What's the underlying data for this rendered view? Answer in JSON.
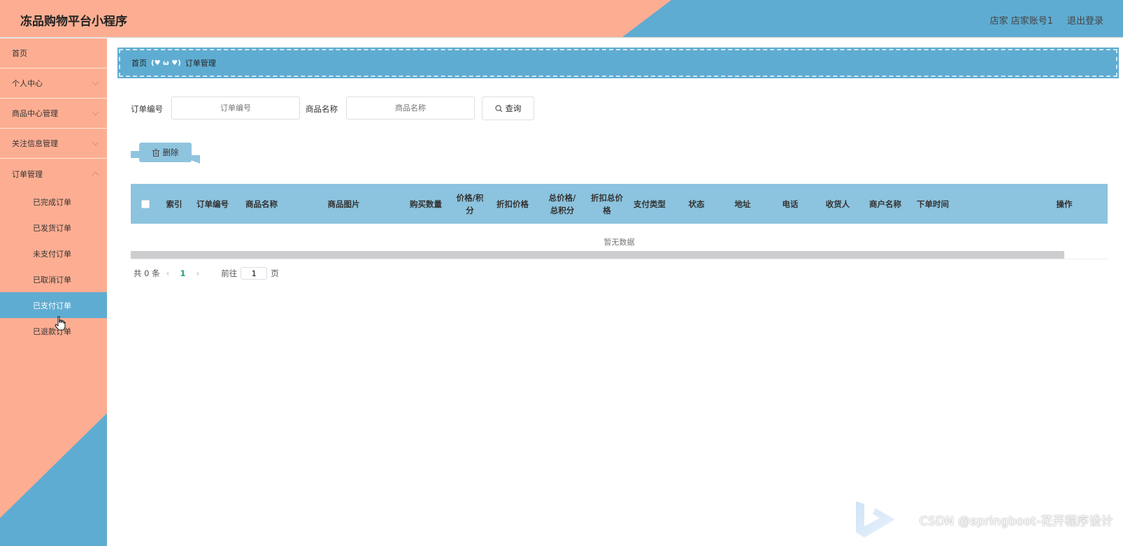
{
  "header": {
    "app_title": "冻品购物平台小程序",
    "user_info": "店家 店家账号1",
    "logout_label": "退出登录"
  },
  "sidebar": {
    "items": [
      {
        "label": "首页",
        "has_children": false
      },
      {
        "label": "个人中心",
        "has_children": true
      },
      {
        "label": "商品中心管理",
        "has_children": true
      },
      {
        "label": "关注信息管理",
        "has_children": true
      },
      {
        "label": "订单管理",
        "has_children": true
      }
    ],
    "sub_items": [
      {
        "label": "已完成订单",
        "active": false
      },
      {
        "label": "已发货订单",
        "active": false
      },
      {
        "label": "未支付订单",
        "active": false
      },
      {
        "label": "已取消订单",
        "active": false
      },
      {
        "label": "已支付订单",
        "active": true
      },
      {
        "label": "已退款订单",
        "active": false
      }
    ]
  },
  "breadcrumb": {
    "home": "首页",
    "separator": "(♥ ω ♥)",
    "current": "订单管理"
  },
  "search": {
    "order_no_label": "订单编号",
    "order_no_placeholder": "订单编号",
    "product_name_label": "商品名称",
    "product_name_placeholder": "商品名称",
    "query_label": "查询"
  },
  "actions": {
    "delete_label": "删除"
  },
  "table": {
    "columns": [
      "索引",
      "订单编号",
      "商品名称",
      "商品图片",
      "购买数量",
      "价格/积分",
      "折扣价格",
      "总价格/总积分",
      "折扣总价格",
      "支付类型",
      "状态",
      "地址",
      "电话",
      "收货人",
      "商户名称",
      "下单时间",
      "操作"
    ],
    "empty_text": "暂无数据"
  },
  "pagination": {
    "total_text": "共 0 条",
    "current_page": "1",
    "goto_label": "前往",
    "goto_value": "1",
    "page_suffix": "页"
  },
  "watermark": "CSDN @springboot-花开程序设计",
  "colors": {
    "salmon": "#fdae92",
    "blue": "#5facd2",
    "table_header": "#8cc3de",
    "page_active": "#1ea082"
  }
}
